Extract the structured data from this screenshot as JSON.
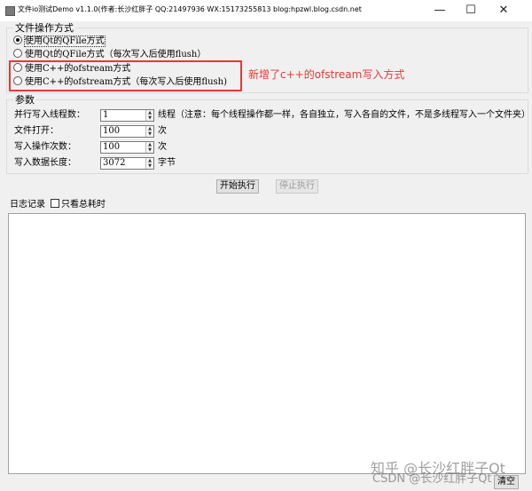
{
  "window": {
    "title": "文件io测试Demo v1.1.0(作者:长沙红胖子 QQ:21497936 WX:15173255813 blog:hpzwl.blog.csdn.net",
    "min_glyph": "—",
    "max_glyph": "☐",
    "close_glyph": "✕"
  },
  "file_op_group": {
    "title": "文件操作方式",
    "options": [
      {
        "label": "使用Qt的QFile方式",
        "checked": true
      },
      {
        "label": "使用Qt的QFile方式（每次写入后使用flush）",
        "checked": false
      },
      {
        "label": "使用C++的ofstream方式",
        "checked": false
      },
      {
        "label": "使用C++的ofstream方式（每次写入后使用flush)",
        "checked": false
      }
    ]
  },
  "annotation": {
    "text": "新增了c++的ofstream写入方式",
    "color": "#e53935"
  },
  "params_group": {
    "title": "参数",
    "rows": [
      {
        "label": "并行写入线程数：",
        "value": "1",
        "unit": "线程（注意：每个线程操作都一样，各自独立，写入各自的文件，不是多线程写入一个文件夹）"
      },
      {
        "label": "文件打开：",
        "value": "100",
        "unit": "次"
      },
      {
        "label": "写入操作次数：",
        "value": "100",
        "unit": "次"
      },
      {
        "label": "写入数据长度：",
        "value": "3072",
        "unit": "字节"
      }
    ]
  },
  "actions": {
    "start_label": "开始执行",
    "stop_label": "停止执行"
  },
  "log": {
    "label": "日志记录",
    "checkbox_label": "只看总耗时",
    "checkbox_checked": false
  },
  "footer": {
    "clear_label": "清空"
  },
  "watermarks": {
    "zhihu": "知乎 @长沙红胖子Qt",
    "csdn": "CSDN @长沙红胖子Qt"
  }
}
